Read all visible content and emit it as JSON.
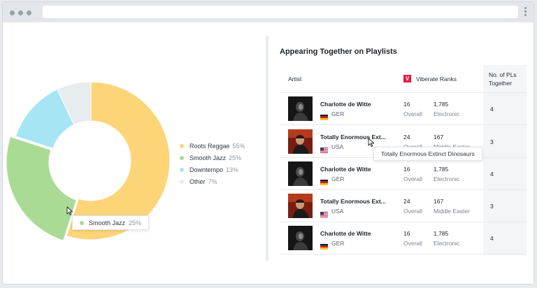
{
  "browser": {
    "address": ""
  },
  "colors": {
    "roots_reggae": "#fcd579",
    "smooth_jazz": "#aadb95",
    "downtempo": "#a6e5f3",
    "other": "#e7ecef",
    "viberate_brand": "#e8193c"
  },
  "chart_data": {
    "type": "pie",
    "variant": "donut",
    "categories": [
      "Roots Reggae",
      "Smooth Jazz",
      "Downtempo",
      "Other"
    ],
    "values": [
      55,
      25,
      13,
      7
    ],
    "unit": "%",
    "highlighted": "Smooth Jazz"
  },
  "legend": [
    {
      "label": "Roots Reggae",
      "value": "55%"
    },
    {
      "label": "Smooth Jazz",
      "value": "25%"
    },
    {
      "label": "Downtempo",
      "value": "13%"
    },
    {
      "label": "Other",
      "value": "7%"
    }
  ],
  "chart_tooltip": {
    "label": "Smooth Jazz",
    "value": "25%"
  },
  "panel": {
    "title": "Appearing Together on Playlists",
    "columns": {
      "artist": "Artist",
      "ranks": "Viberate Ranks",
      "count": "No. of PLs Together"
    },
    "viberate_logo_letter": "V",
    "rows": [
      {
        "name": "Charlotte de Witte",
        "flag": "germany-flag-icon",
        "country": "GER",
        "rank": "16",
        "rank_label": "Overall",
        "genre_rank": "1,785",
        "genre": "Electronic",
        "count": "4"
      },
      {
        "name": "Totally Enormous Ext...",
        "flag": "usa-flag-icon",
        "country": "USA",
        "rank": "24",
        "rank_label": "Overall",
        "genre_rank": "167",
        "genre": "Middle Easter",
        "count": "3"
      },
      {
        "name": "Charlotte de Witte",
        "flag": "germany-flag-icon",
        "country": "GER",
        "rank": "16",
        "rank_label": "Overall",
        "genre_rank": "1,785",
        "genre": "Electronic",
        "count": "4"
      },
      {
        "name": "Totally Enormous Ext...",
        "flag": "usa-flag-icon",
        "country": "USA",
        "rank": "24",
        "rank_label": "Overall",
        "genre_rank": "167",
        "genre": "Middle Easter",
        "count": "3"
      },
      {
        "name": "Charlotte de Witte",
        "flag": "germany-flag-icon",
        "country": "GER",
        "rank": "16",
        "rank_label": "Overall",
        "genre_rank": "1,785",
        "genre": "Electronic",
        "count": "4"
      }
    ],
    "row_tooltip": "Totally Enormous Extinct Dinosaurs"
  }
}
